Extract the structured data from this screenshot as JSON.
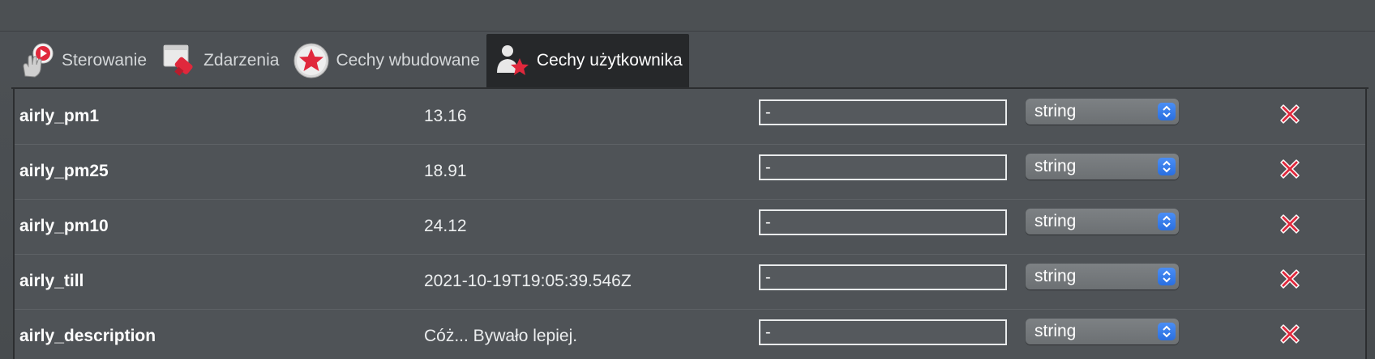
{
  "tabs": [
    {
      "label": "Sterowanie",
      "icon": "touch-control-icon",
      "active": false
    },
    {
      "label": "Zdarzenia",
      "icon": "events-pin-icon",
      "active": false
    },
    {
      "label": "Cechy wbudowane",
      "icon": "builtin-star-icon",
      "active": false
    },
    {
      "label": "Cechy użytkownika",
      "icon": "user-star-icon",
      "active": true
    }
  ],
  "rows": [
    {
      "name": "airly_pm1",
      "value": "13.16",
      "field": "-",
      "type": "string"
    },
    {
      "name": "airly_pm25",
      "value": "18.91",
      "field": "-",
      "type": "string"
    },
    {
      "name": "airly_pm10",
      "value": "24.12",
      "field": "-",
      "type": "string"
    },
    {
      "name": "airly_till",
      "value": "2021-10-19T19:05:39.546Z",
      "field": "-",
      "type": "string"
    },
    {
      "name": "airly_description",
      "value": "Cóż... Bywało lepiej.",
      "field": "-",
      "type": "string"
    }
  ],
  "colors": {
    "accent_red": "#e0283c",
    "select_arrow_blue": "#2f74e6",
    "active_tab_bg": "#26282a"
  }
}
